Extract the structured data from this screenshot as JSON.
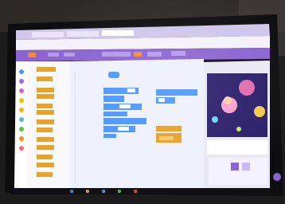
{
  "photo": {
    "subject": "laptop-screen-showing-block-coding-editor",
    "colors": {
      "room": "#1d1c1c",
      "laptop_frame": "#0e0e10",
      "tab_bar": "#cfc6ea",
      "toolbar": "#8a63d2",
      "code_area": "#eef0fb",
      "block_blue": "#4c97ff",
      "block_orange": "#e6a22a",
      "stage_space": "#2b1f6b",
      "taskbar": "#101014"
    }
  }
}
